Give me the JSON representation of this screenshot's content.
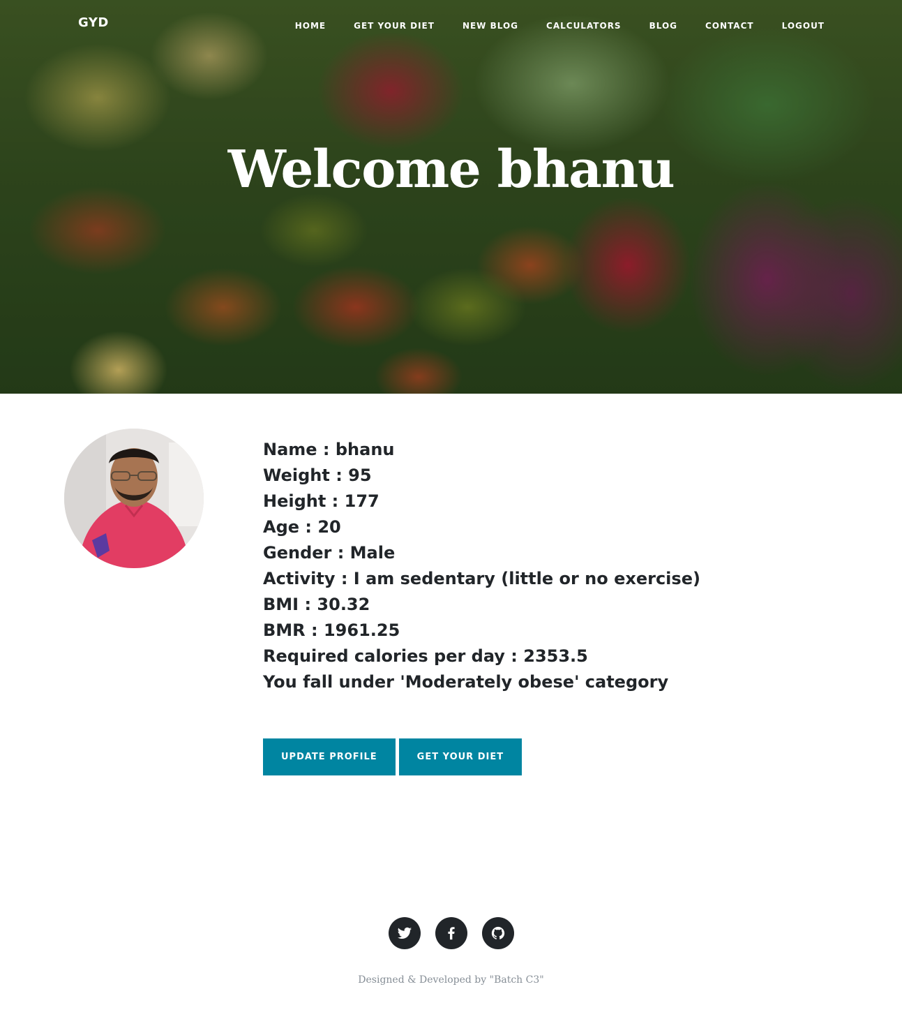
{
  "nav": {
    "brand": "GYD",
    "links": [
      {
        "label": "HOME"
      },
      {
        "label": "GET YOUR DIET"
      },
      {
        "label": "NEW BLOG"
      },
      {
        "label": "CALCULATORS"
      },
      {
        "label": "BLOG"
      },
      {
        "label": "CONTACT"
      },
      {
        "label": "LOGOUT"
      }
    ]
  },
  "hero": {
    "title": "Welcome bhanu"
  },
  "profile": {
    "lines": [
      "Name : bhanu",
      "Weight : 95",
      "Height : 177",
      "Age : 20",
      "Gender : Male",
      "Activity : I am sedentary (little or no exercise)",
      "BMI : 30.32",
      "BMR : 1961.25",
      "Required calories per day : 2353.5",
      "You fall under 'Moderately obese' category"
    ],
    "buttons": {
      "update": "UPDATE PROFILE",
      "diet": "GET YOUR DIET"
    }
  },
  "footer": {
    "social": [
      {
        "icon": "twitter-icon"
      },
      {
        "icon": "facebook-icon"
      },
      {
        "icon": "github-icon"
      }
    ],
    "credit": "Designed & Developed by \"Batch C3\""
  },
  "colors": {
    "accent": "#0085a1",
    "text": "#212529",
    "muted": "#868e96"
  }
}
